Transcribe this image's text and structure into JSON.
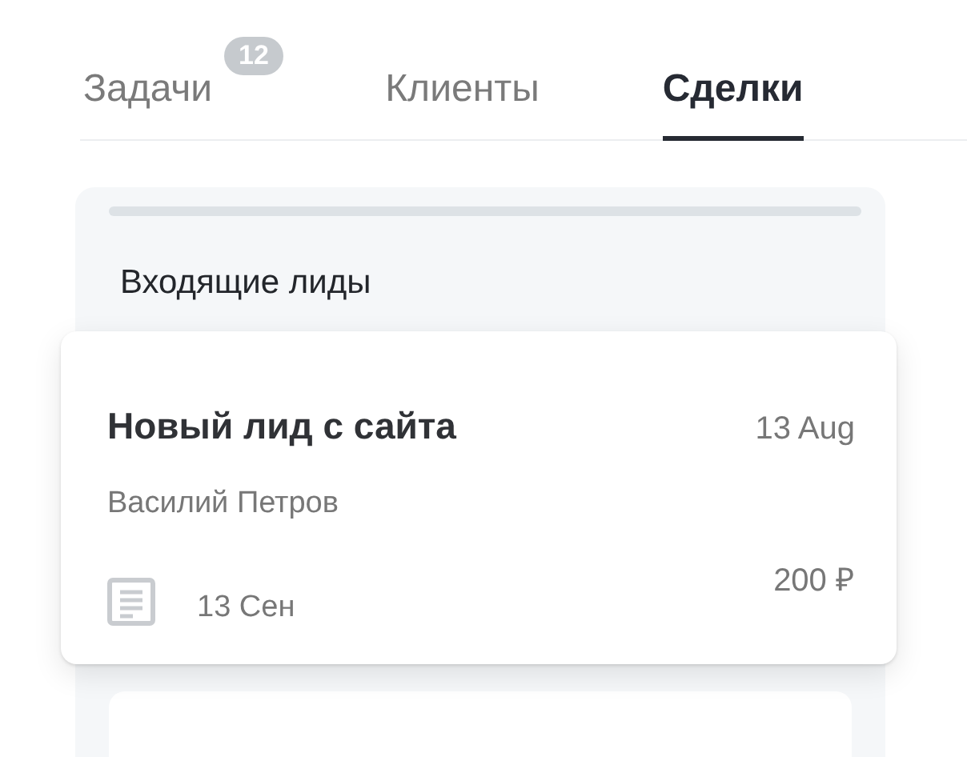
{
  "tabs": [
    {
      "label": "Задачи",
      "selected": false,
      "badge": "12"
    },
    {
      "label": "Клиенты",
      "selected": false
    },
    {
      "label": "Сделки",
      "selected": true
    }
  ],
  "column": {
    "title": "Входящие лиды",
    "cards": [
      {
        "title": "Новый лид с сайта",
        "date": "13 Aug",
        "contact": "Василий Петров",
        "due": "13 Сен",
        "amount": "200 ₽"
      }
    ]
  }
}
